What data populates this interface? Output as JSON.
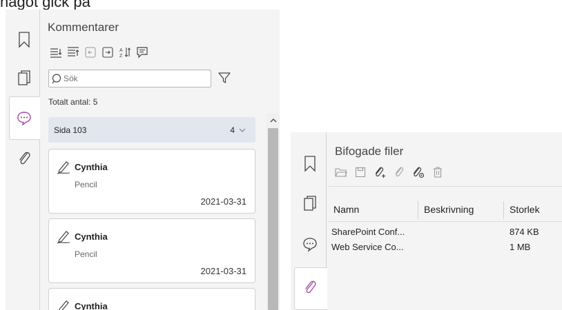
{
  "top_text": "något gick på",
  "comments_panel": {
    "title": "Kommentarer",
    "toolbar_icons": [
      "expand-all-icon",
      "collapse-all-icon",
      "previous-icon",
      "next-icon",
      "sort-icon",
      "comment-icon"
    ],
    "search": {
      "placeholder": "Sök",
      "value": ""
    },
    "filter_icon": "filter-icon",
    "total": "Totalt antal: 5",
    "page_group": {
      "label": "Sida 103",
      "count": "4"
    },
    "comments": [
      {
        "author": "Cynthia",
        "type": "Pencil",
        "date": "2021-03-31"
      },
      {
        "author": "Cynthia",
        "type": "Pencil",
        "date": "2021-03-31"
      },
      {
        "author": "Cynthia",
        "type": "",
        "date": ""
      }
    ]
  },
  "left_sidebar_icons": [
    "bookmark-icon",
    "pages-icon",
    "comments-icon",
    "attachment-icon"
  ],
  "attachments_panel": {
    "title": "Bifogade filer",
    "toolbar_icons": [
      "open-icon",
      "save-icon",
      "add-attachment-icon",
      "remove-attachment-icon",
      "attachment-settings-icon",
      "delete-icon"
    ],
    "columns": [
      "Namn",
      "Beskrivning",
      "Storlek"
    ],
    "files": [
      {
        "name": "SharePoint Conf...",
        "description": "",
        "size": "874 KB"
      },
      {
        "name": "Web Service Co...",
        "description": "",
        "size": "1 MB"
      }
    ]
  },
  "right_sidebar_icons": [
    "bookmark-icon",
    "pages-icon",
    "comments-icon",
    "attachment-icon"
  ],
  "colors": {
    "accent": "#a64ca6",
    "panel_bg": "#f4f4f4",
    "group_header_bg": "#e2e6ee",
    "scroll_thumb": "#b8b8b8"
  }
}
